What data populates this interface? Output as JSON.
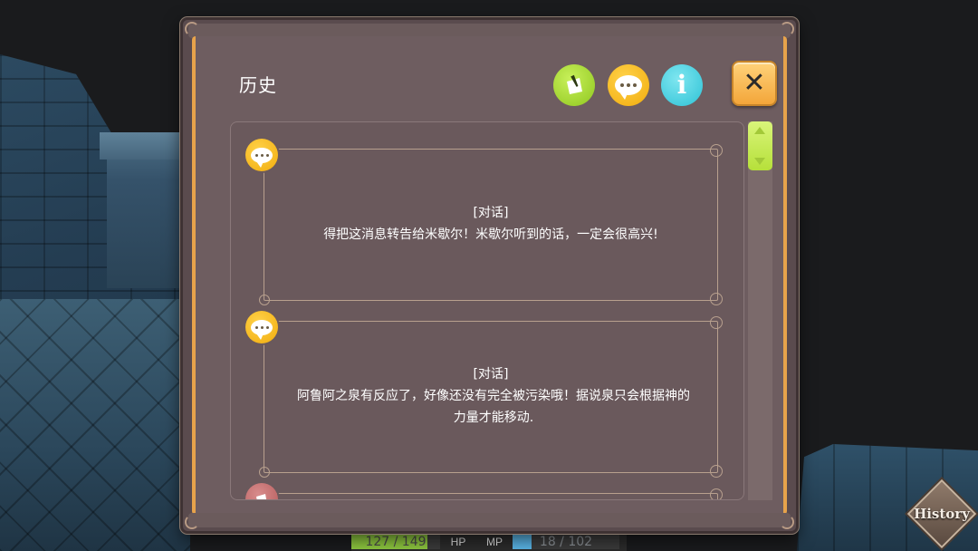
{
  "dialog": {
    "title": "历史",
    "filters": [
      {
        "name": "note-filter",
        "icon": "note-icon",
        "color": "#8fc71f"
      },
      {
        "name": "dialog-filter",
        "icon": "speech-bubble-icon",
        "color": "#f1ac0c"
      },
      {
        "name": "info-filter",
        "icon": "info-icon",
        "label": "i",
        "color": "#2ec2d6"
      }
    ],
    "close_label": "✕"
  },
  "entries": [
    {
      "tag": "[对话]",
      "text": "得把这消息转告给米歇尔！米歇尔听到的话，一定会很高兴!",
      "icon": "speech-bubble-icon"
    },
    {
      "tag": "[对话]",
      "text": "阿鲁阿之泉有反应了，好像还没有完全被污染哦！据说泉只会根据神的力量才能移动.",
      "icon": "speech-bubble-icon"
    },
    {
      "icon": "note-icon"
    }
  ],
  "hud": {
    "hp_text": "127 / 149",
    "hp_label": "HP",
    "mp_label": "MP",
    "mp_text": "18 / 102",
    "hp_fraction": 0.8523,
    "mp_fraction": 0.1765,
    "hp_color": "#8dc63f",
    "mp_color": "#59b3e4"
  },
  "corner_badge": {
    "label": "History"
  },
  "colors": {
    "frame_accent": "#e7a34b",
    "panel": "#6e5d60"
  }
}
